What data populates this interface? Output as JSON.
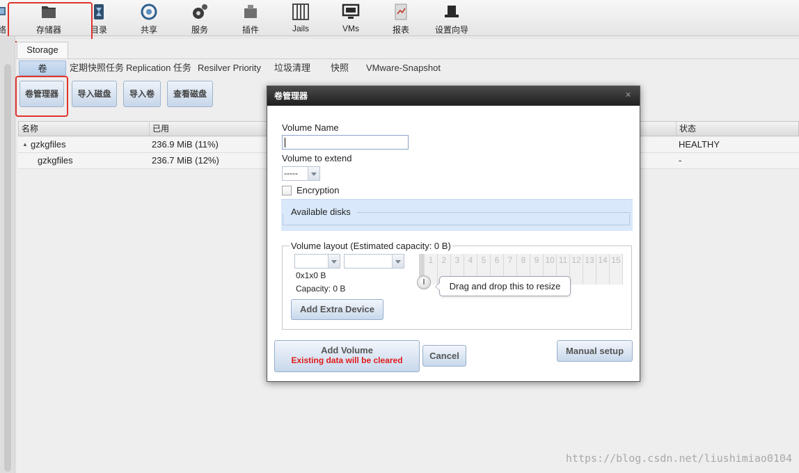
{
  "toolbar": {
    "items": [
      {
        "label": "络",
        "icon": "network-icon"
      },
      {
        "label": "存储器",
        "icon": "storage-folder-icon"
      },
      {
        "label": "目录",
        "icon": "directory-icon"
      },
      {
        "label": "共享",
        "icon": "sharing-icon"
      },
      {
        "label": "服务",
        "icon": "services-gear-icon"
      },
      {
        "label": "插件",
        "icon": "plugins-icon"
      },
      {
        "label": "Jails",
        "icon": "jails-icon"
      },
      {
        "label": "VMs",
        "icon": "vms-monitor-icon"
      },
      {
        "label": "报表",
        "icon": "reports-icon"
      },
      {
        "label": "设置向导",
        "icon": "wizard-hat-icon"
      }
    ]
  },
  "tabs": {
    "storage": "Storage"
  },
  "subtabs": [
    "卷",
    "定期快照任务",
    "Replication 任务",
    "Resilver Priority",
    "垃圾清理",
    "快照",
    "VMware-Snapshot"
  ],
  "actions": [
    "卷管理器",
    "导入磁盘",
    "导入卷",
    "查看磁盘"
  ],
  "grid": {
    "columns": [
      "名称",
      "已用",
      "状态"
    ],
    "rows": [
      {
        "name": "gzkgfiles",
        "used": "236.9 MiB (11%)",
        "status": "HEALTHY"
      },
      {
        "name": "gzkgfiles",
        "used": "236.7 MiB (12%)",
        "status": "-"
      }
    ]
  },
  "dialog": {
    "title": "卷管理器",
    "volume_name_label": "Volume Name",
    "volume_name_value": "",
    "volume_extend_label": "Volume to extend",
    "volume_extend_value": "-----",
    "encryption_label": "Encryption",
    "encryption_checked": false,
    "available_disks_label": "Available disks",
    "layout_legend": "Volume layout (Estimated capacity: 0 B)",
    "layout_dims": "0x1x0 B",
    "capacity_text": "Capacity: 0 B",
    "disk_slots": [
      "1",
      "2",
      "3",
      "4",
      "5",
      "6",
      "7",
      "8",
      "9",
      "10",
      "11",
      "12",
      "13",
      "14",
      "15"
    ],
    "resize_tip": "Drag and drop this to resize",
    "add_extra_device": "Add Extra Device",
    "add_volume": "Add Volume",
    "add_volume_warning": "Existing data will be cleared",
    "cancel": "Cancel",
    "manual_setup": "Manual setup"
  },
  "watermark": "https://blog.csdn.net/liushimiao0104",
  "colors": {
    "highlight_box": "#e0332c",
    "warning_text": "#e01a1a",
    "dialog_title_bg": "#2a2a2a"
  }
}
